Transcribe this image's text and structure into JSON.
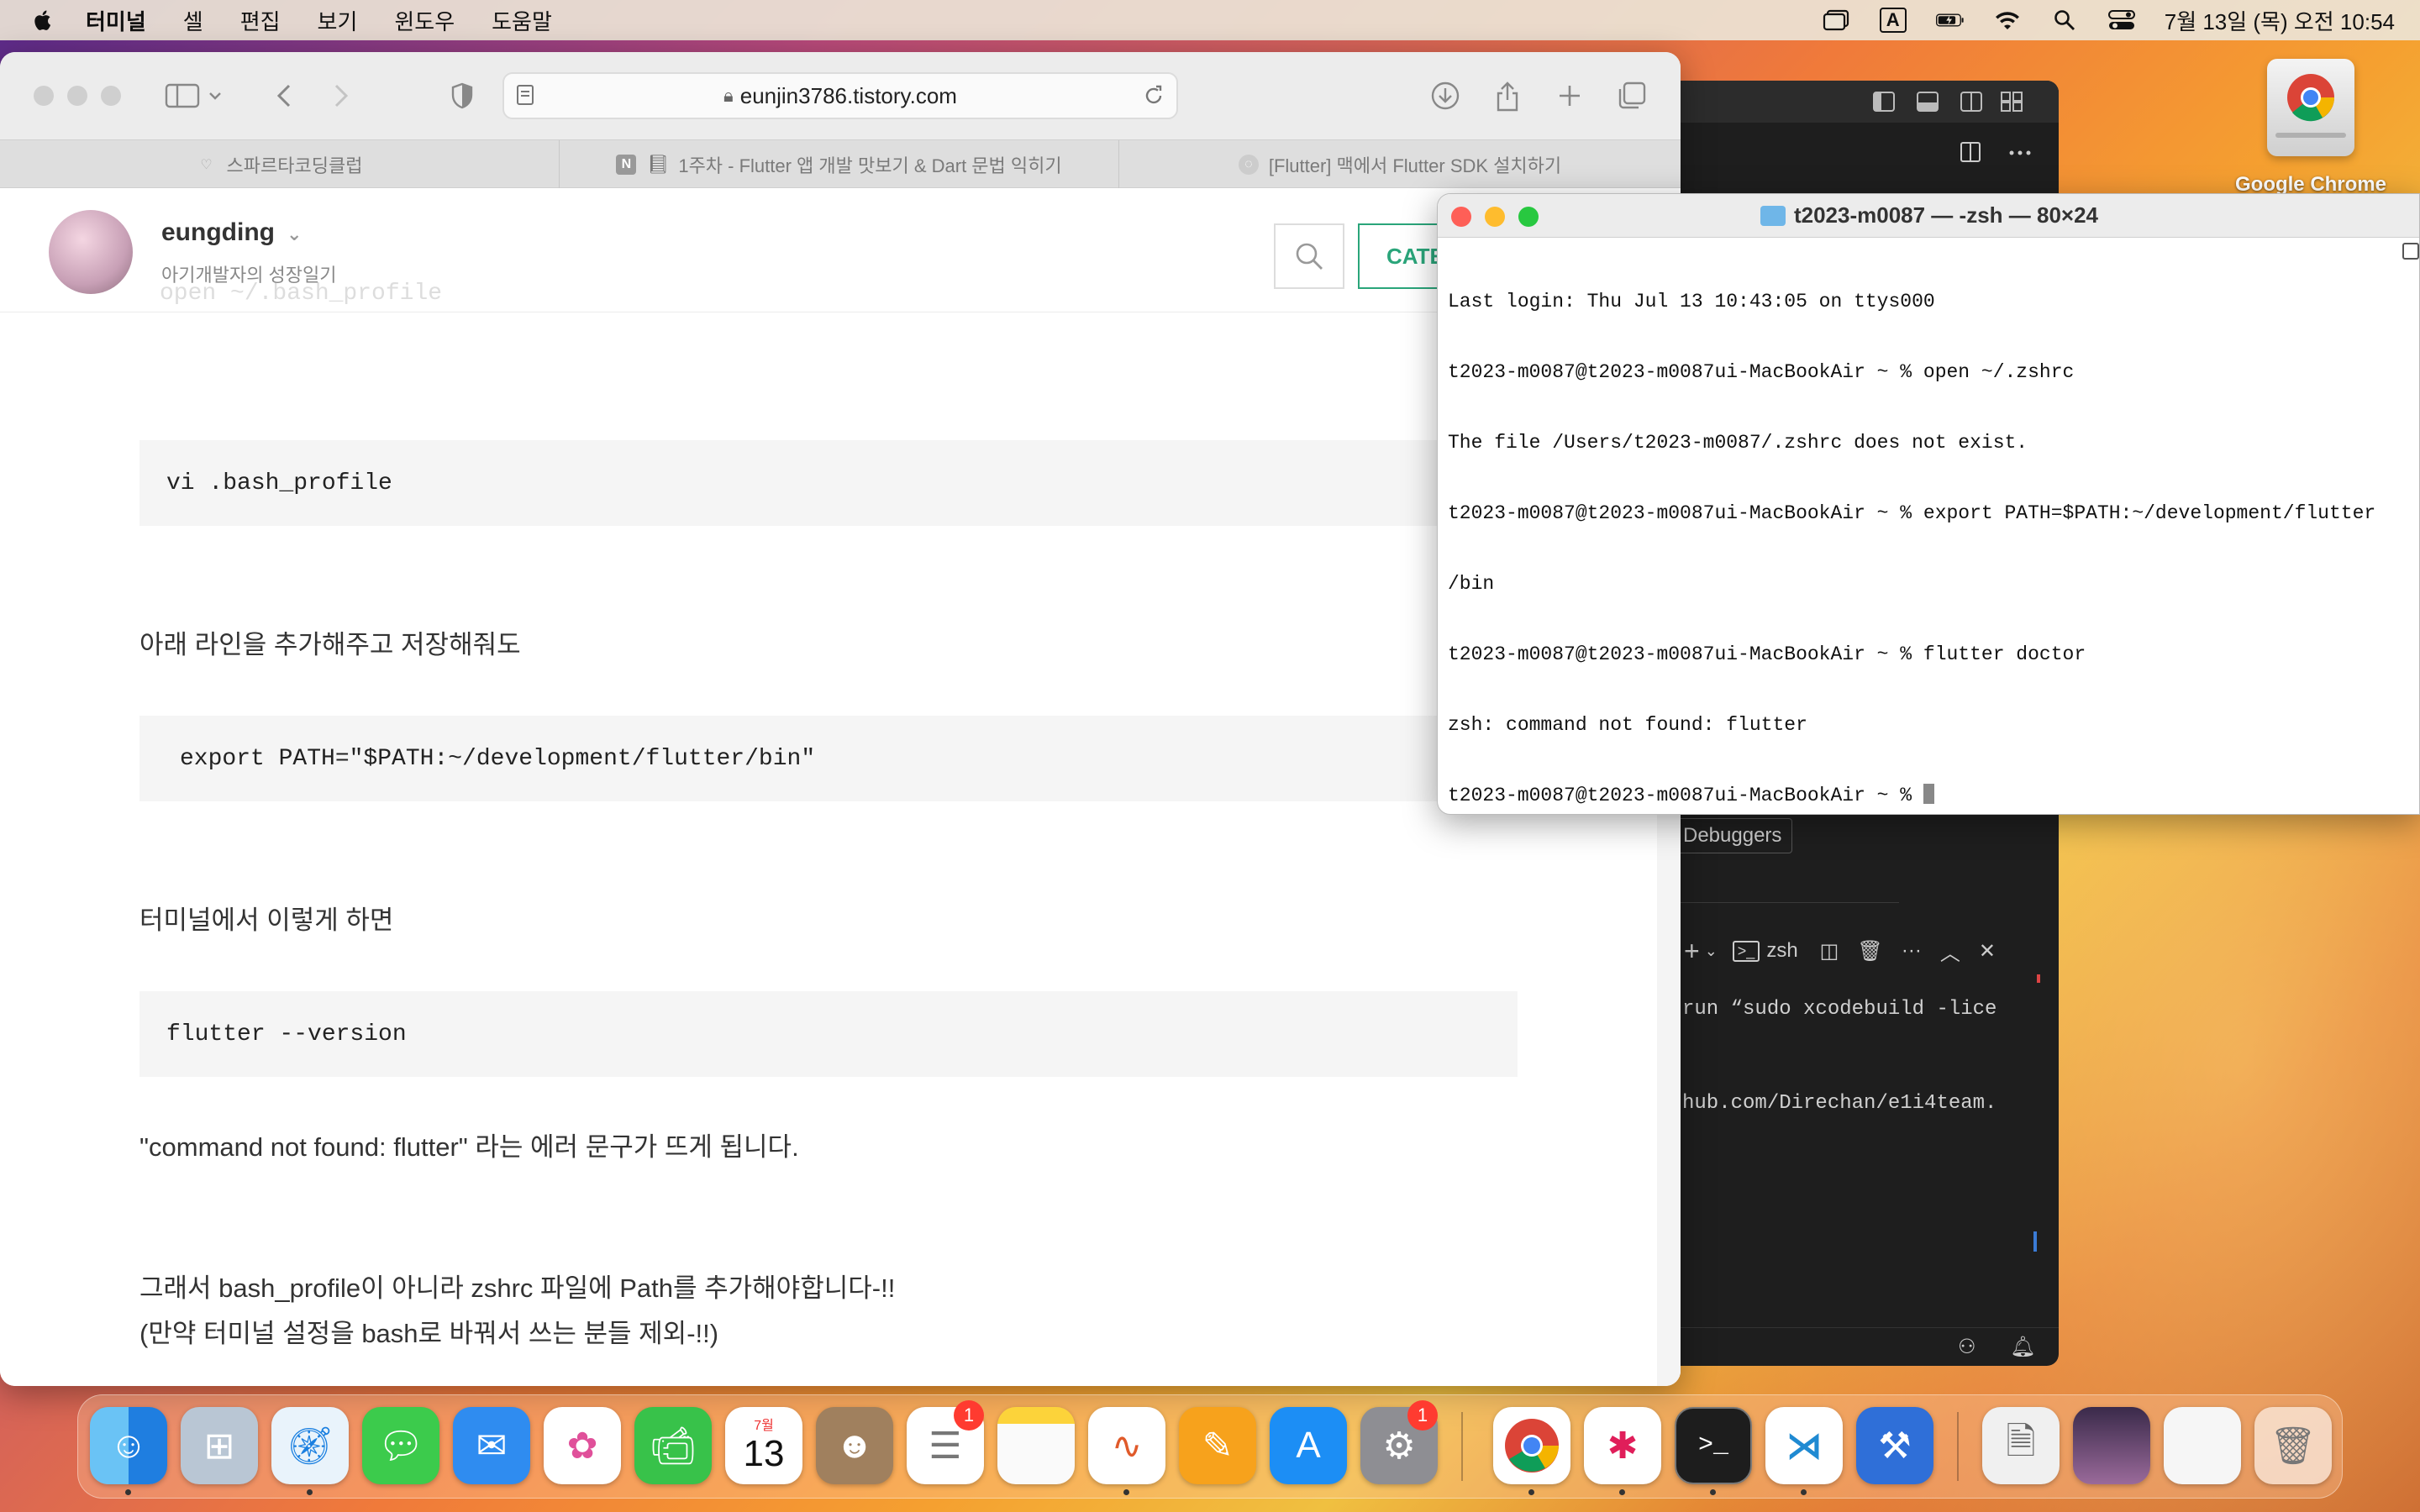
{
  "menubar": {
    "items": [
      "터미널",
      "셀",
      "편집",
      "보기",
      "윈도우",
      "도움말"
    ],
    "clock": "7월 13일 (목) 오전 10:54",
    "input_indicator": "A"
  },
  "safari": {
    "url": "eunjin3786.tistory.com",
    "tabs": [
      {
        "label": "스파르타코딩클럽"
      },
      {
        "label": "1주차 - Flutter 앱 개발 맛보기 & Dart 문법 익히기",
        "favicon": "N"
      },
      {
        "label": "[Flutter] 맥에서 Flutter SDK 설치하기"
      }
    ],
    "blog": {
      "name": "eungding",
      "subtitle": "아기개발자의 성장일기",
      "cate_label": "CATE",
      "faded_code": "open ~/.bash_profile"
    },
    "content": {
      "code1": "vi .bash_profile",
      "para1": "아래 라인을 추가해주고 저장해줘도",
      "code2": "export PATH=\"$PATH:~/development/flutter/bin\"",
      "para2": "터미널에서 이렇게 하면",
      "code3": "flutter --version",
      "para3": "\"command not found: flutter\" 라는 에러 문구가 뜨게 됩니다.",
      "para4": "그래서 bash_profile이 아니라 zshrc 파일에 Path를 추가해야합니다-!!",
      "para5": "(만약 터미널 설정을 bash로 바꿔서 쓰는 분들 제외-!!)"
    }
  },
  "terminal": {
    "title": "t2023-m0087 — -zsh — 80×24",
    "lines": [
      "Last login: Thu Jul 13 10:43:05 on ttys000",
      "t2023-m0087@t2023-m0087ui-MacBookAir ~ % open ~/.zshrc",
      "The file /Users/t2023-m0087/.zshrc does not exist.",
      "t2023-m0087@t2023-m0087ui-MacBookAir ~ % export PATH=$PATH:~/development/flutter",
      "/bin",
      "t2023-m0087@t2023-m0087ui-MacBookAir ~ % flutter doctor",
      "zsh: command not found: flutter",
      "t2023-m0087@t2023-m0087ui-MacBookAir ~ % "
    ]
  },
  "vscode": {
    "debuggers_label": "Debuggers",
    "terminal_shell": "zsh",
    "line1": "run “sudo xcodebuild -lice",
    "line2": "hub.com/Direchan/e1i4team."
  },
  "desktop": {
    "drive_label": "Google Chrome"
  },
  "dock": {
    "calendar_month": "7월",
    "calendar_day": "13",
    "reminders_badge": "1",
    "settings_badge": "1"
  }
}
